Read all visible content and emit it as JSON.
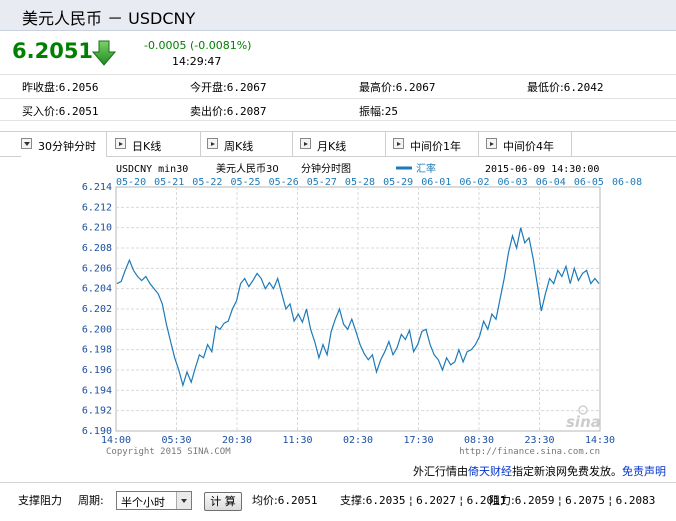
{
  "title": "美元人民币 － USDCNY",
  "quote": {
    "price": "6.2051",
    "change": "-0.0005 (-0.0081%)",
    "time": "14:29:47",
    "color_down": "#008000"
  },
  "stats": {
    "row1": [
      {
        "label": "昨收盘:",
        "value": "6.2056"
      },
      {
        "label": "今开盘:",
        "value": "6.2067"
      },
      {
        "label": "最高价:",
        "value": "6.2067"
      },
      {
        "label": "最低价:",
        "value": "6.2042"
      }
    ],
    "row2": [
      {
        "label": "买入价:",
        "value": "6.2051"
      },
      {
        "label": "卖出价:",
        "value": "6.2087"
      },
      {
        "label": "振幅:",
        "value": "25"
      }
    ]
  },
  "tabs": [
    {
      "label": "30分钟分时",
      "active": true
    },
    {
      "label": "日K线",
      "active": false
    },
    {
      "label": "周K线",
      "active": false
    },
    {
      "label": "月K线",
      "active": false
    },
    {
      "label": "中间价1年",
      "active": false
    },
    {
      "label": "中间价4年",
      "active": false
    }
  ],
  "chart_header": {
    "symbol": "USDCNY min30",
    "name": "美元人民币30",
    "kind": "分钟分时图",
    "legend": "汇率",
    "datetime": "2015-06-09 14:30:00",
    "line_color": "#1c7ab8"
  },
  "chart_data": {
    "type": "line",
    "title": "",
    "xlabel": "",
    "ylabel": "",
    "ylim": [
      6.19,
      6.214
    ],
    "y_ticks": [
      "6.214",
      "6.212",
      "6.210",
      "6.208",
      "6.206",
      "6.204",
      "6.202",
      "6.200",
      "6.198",
      "6.196",
      "6.194",
      "6.192",
      "6.190"
    ],
    "date_labels": [
      "05-20",
      "05-21",
      "05-22",
      "05-25",
      "05-26",
      "05-27",
      "05-28",
      "05-29",
      "06-01",
      "06-02",
      "06-03",
      "06-04",
      "06-05",
      "06-08"
    ],
    "time_labels": [
      "14:00",
      "05:30",
      "20:30",
      "11:30",
      "02:30",
      "17:30",
      "08:30",
      "23:30",
      "14:30"
    ],
    "grid": true,
    "series": [
      {
        "name": "汇率",
        "values": [
          6.2045,
          6.2047,
          6.2058,
          6.2068,
          6.2058,
          6.2052,
          6.2048,
          6.2052,
          6.2045,
          6.204,
          6.2035,
          6.2025,
          6.2005,
          6.1988,
          6.1972,
          6.196,
          6.1945,
          6.1958,
          6.1948,
          6.1962,
          6.1975,
          6.1972,
          6.1985,
          6.1978,
          6.2003,
          6.2,
          6.2006,
          6.2008,
          6.202,
          6.2028,
          6.2045,
          6.205,
          6.2042,
          6.2048,
          6.2055,
          6.205,
          6.204,
          6.2046,
          6.204,
          6.205,
          6.2035,
          6.202,
          6.2025,
          6.2008,
          6.2015,
          6.2007,
          6.202,
          6.2,
          6.1988,
          6.1972,
          6.1985,
          6.1975,
          6.1998,
          6.201,
          6.202,
          6.2005,
          6.2,
          6.201,
          6.1998,
          6.1985,
          6.1976,
          6.197,
          6.1975,
          6.1958,
          6.197,
          6.1978,
          6.1988,
          6.1975,
          6.1982,
          6.1995,
          6.199,
          6.1999,
          6.1978,
          6.1985,
          6.1998,
          6.2,
          6.1985,
          6.1975,
          6.197,
          6.196,
          6.1972,
          6.1965,
          6.1968,
          6.198,
          6.1968,
          6.1978,
          6.198,
          6.1985,
          6.1993,
          6.2008,
          6.2,
          6.2015,
          6.201,
          6.203,
          6.205,
          6.2075,
          6.2092,
          6.208,
          6.21,
          6.2085,
          6.209,
          6.207,
          6.2045,
          6.2018,
          6.2035,
          6.205,
          6.2045,
          6.2058,
          6.2052,
          6.2062,
          6.2045,
          6.206,
          6.2048,
          6.2055,
          6.2058,
          6.2045,
          6.205,
          6.2045
        ]
      }
    ]
  },
  "watermarks": {
    "copyright": "Copyright 2015 SINA.COM",
    "url": "http://finance.sina.com.cn",
    "logo": "sina"
  },
  "footer": {
    "prefix": "外汇行情由",
    "provider": "倚天财经",
    "mid": "指定新浪网免费发放。",
    "disclaimer": "免责声明"
  },
  "toolbar": {
    "label": "支撑阻力",
    "period_label": "周期:",
    "period_value": "半个小时",
    "calc": "计 算",
    "avg_label": "均价:",
    "avg_value": "6.2051",
    "support_label": "支撑:",
    "supports": [
      "6.2035",
      "6.2027",
      "6.2011"
    ],
    "resist_label": "阻力:",
    "resists": [
      "6.2059",
      "6.2075",
      "6.2083"
    ]
  }
}
